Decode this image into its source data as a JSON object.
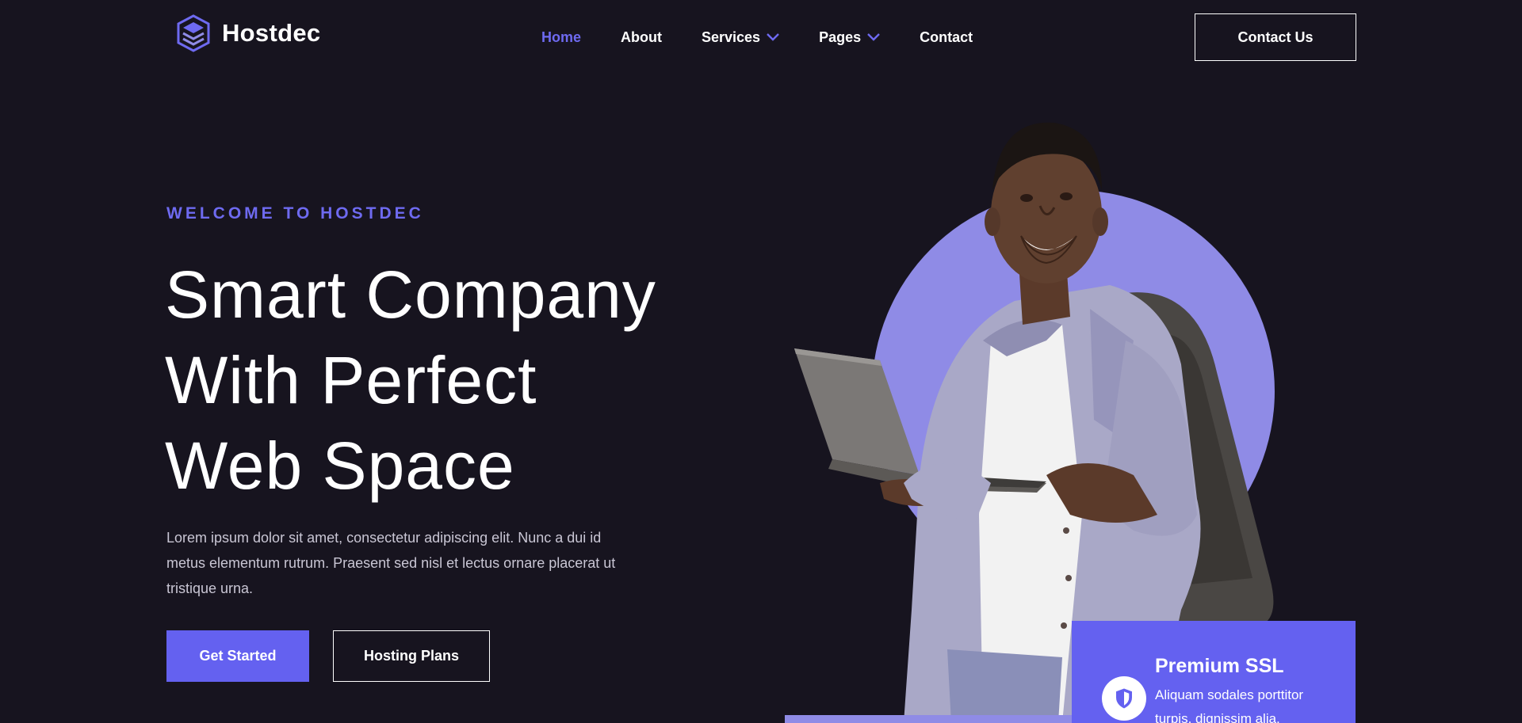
{
  "brand": {
    "name": "Hostdec",
    "logo_icon": "layered-hexagon-logo-icon"
  },
  "nav": {
    "items": [
      {
        "label": "Home",
        "active": true
      },
      {
        "label": "About",
        "active": false
      },
      {
        "label": "Services",
        "has_dropdown": true
      },
      {
        "label": "Pages",
        "has_dropdown": true
      },
      {
        "label": "Contact",
        "active": false
      }
    ],
    "cta_label": "Contact Us"
  },
  "hero": {
    "eyebrow": "WELCOME TO HOSTDEC",
    "title_lines": [
      "Smart Company",
      "With Perfect",
      "Web Space"
    ],
    "description": "Lorem ipsum dolor sit amet, consectetur adipiscing elit. Nunc a dui id metus elementum rutrum. Praesent sed nisl et lectus ornare placerat ut tristique urna.",
    "primary_button": "Get Started",
    "secondary_button": "Hosting Plans"
  },
  "ssl_card": {
    "title": "Premium SSL",
    "text": "Aliquam sodales porttitor turpis, dignissim alia.",
    "icon": "shield-icon"
  },
  "colors": {
    "background": "#17141f",
    "accent": "#6461f0",
    "accent_light": "#8f8be6",
    "text": "#ffffff",
    "muted_text": "#c9c6d4"
  }
}
